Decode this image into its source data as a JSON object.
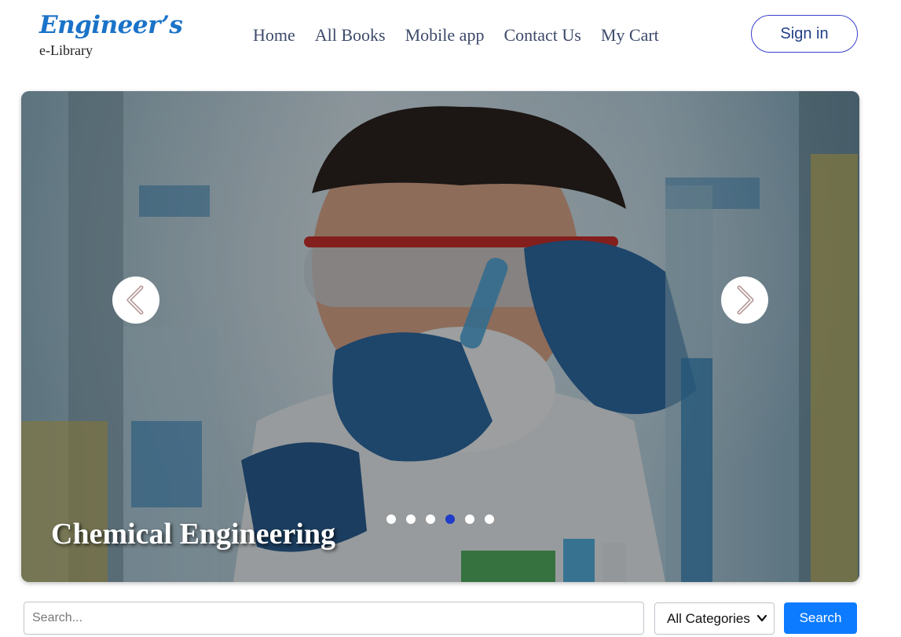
{
  "logo": {
    "main": "Engineer’s",
    "sub": "e-Library"
  },
  "nav": {
    "items": [
      "Home",
      "All Books",
      "Mobile app",
      "Contact Us",
      "My Cart"
    ]
  },
  "auth": {
    "signin_label": "Sign in"
  },
  "carousel": {
    "slide_title": "Chemical Engineering",
    "active_index": 3,
    "dot_count": 6,
    "image_description_icon": "chemistry-lab-photo"
  },
  "search": {
    "placeholder": "Search...",
    "value": "",
    "category_selected": "All Categories",
    "button_label": "Search"
  },
  "colors": {
    "brand": "#1a73c8",
    "nav_text": "#3d4a6b",
    "signin_border": "#3b3fcf",
    "active_dot": "#1e3cc8",
    "search_button": "#0d7bff"
  }
}
